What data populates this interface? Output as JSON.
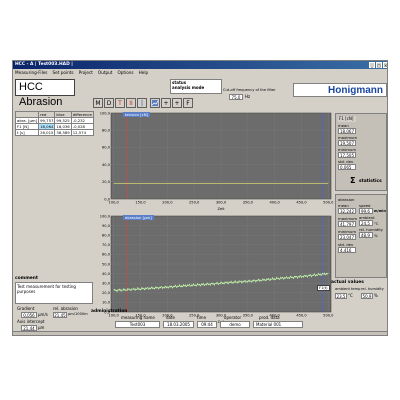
{
  "window": {
    "title": "HCC - A | Test003.HAD |"
  },
  "menu": [
    "Measuring-Files",
    "Set points",
    "Project",
    "Output",
    "Options",
    "Help"
  ],
  "header": {
    "app_title": "HCC Abrasion",
    "status_label": "status",
    "status_value": "analysis mode",
    "cutoff_label": "Cut-off frequency of the filter",
    "cutoff_value": "75,0",
    "cutoff_unit": "Hz",
    "brand": "Honigmann"
  },
  "toolbar": [
    "M",
    "D",
    "T",
    "II",
    "|",
    "chart",
    "+",
    "+",
    "F"
  ],
  "value_table": {
    "headers": [
      "",
      "red",
      "blue",
      "difference"
    ],
    "rows": [
      [
        "abra. [µm]",
        "99,757",
        "99,525",
        "-0,232"
      ],
      [
        "F1 [N]",
        "18,064",
        "18,036",
        "-0,028"
      ],
      [
        "t [s]",
        "26,015",
        "38,589",
        "12,574"
      ]
    ]
  },
  "tension_chart": {
    "label": "tension [cN]",
    "y_ticks": [
      "100,0",
      "80,0",
      "60,0",
      "40,0",
      "20,0",
      "0,0"
    ],
    "x_ticks": [
      "100,0",
      "150,0",
      "200,0",
      "250,0",
      "300,0",
      "350,0",
      "400,0",
      "450,0",
      "500,0"
    ],
    "xlabel": "Zeit"
  },
  "abrasion_chart": {
    "label": "abrasion [µm]",
    "y_ticks": [
      "100,0",
      "90,0",
      "80,0",
      "70,0",
      "60,0",
      "50,0",
      "40,0",
      "30,0",
      "20,0",
      "10,0",
      "0,0"
    ],
    "x_ticks": [
      "100,0",
      "150,0",
      "200,0",
      "250,0",
      "300,0",
      "350,0",
      "400,0",
      "450,0",
      "500,0"
    ],
    "xlabel": "Zeit",
    "cursor_label": "F1(t)"
  },
  "chart_data": [
    {
      "type": "line",
      "xlabel": "Zeit",
      "ylabel": "tension [cN]",
      "xlim": [
        95,
        505
      ],
      "ylim": [
        0,
        100
      ],
      "series": [
        {
          "name": "tension [cN]",
          "x": [
            100,
            500
          ],
          "values": [
            18.1,
            18.1
          ]
        }
      ],
      "cursors": {
        "red": 126.015,
        "blue": 488.589
      },
      "grid": true
    },
    {
      "type": "line",
      "xlabel": "Zeit",
      "ylabel": "abrasion [µm]",
      "xlim": [
        95,
        505
      ],
      "ylim": [
        0,
        100
      ],
      "series": [
        {
          "name": "abrasion [µm]",
          "x": [
            100,
            150,
            200,
            250,
            300,
            350,
            400,
            450,
            500
          ],
          "values": [
            22.5,
            24.0,
            26.0,
            28.0,
            30.0,
            32.0,
            34.5,
            37.0,
            40.0
          ]
        }
      ],
      "cursors": {
        "red": 126.015,
        "blue": 488.589
      },
      "grid": true
    }
  ],
  "stats1": {
    "title": "F1 [cN]",
    "mean_label": "mean",
    "mean": "18,067",
    "maximum_label": "maximum",
    "maximum": "19,507",
    "minimum_label": "minimum",
    "minimum": "17,505",
    "std_label": "std. dev",
    "std": "0,065"
  },
  "stats_heading": {
    "sigma": "Σ",
    "label": "statistics"
  },
  "stats2": {
    "title": "abrasion",
    "mean_label": "mean",
    "mean": "32,242",
    "maximum_label": "maximum",
    "maximum": "41,797",
    "minimum_label": "minimum",
    "minimum": "23,047",
    "std_label": "std. dev",
    "std": "4,416"
  },
  "settings": {
    "speed_label": "speed",
    "speed": "99,6",
    "speed_unit": "m/min",
    "ambient_label": "ambient temp.",
    "ambient": "24,5",
    "ambient_unit": "°C",
    "humidity_label": "rel. humidity",
    "humidity": "48,9",
    "humidity_unit": "%"
  },
  "comment": {
    "title": "comment",
    "text": "Test measurement for testing purposes"
  },
  "gradient": {
    "grad_label": "Gradient",
    "rel_label": "rel. abrasion",
    "grad": "0,056",
    "grad_unit": "µm/s",
    "rel": "21,45",
    "rel_unit": "µm/1000m",
    "intercept_label": "Axis intercept",
    "intercept": "21,44",
    "intercept_unit": "µm"
  },
  "administration": {
    "title": "administration",
    "headers": [
      "measuring name",
      "date",
      "time",
      "operator",
      "prod. data"
    ],
    "values": [
      "Test003",
      "18.03.2005",
      "09:44",
      "demo",
      "Material 001"
    ]
  },
  "actual": {
    "title": "actual values",
    "temp_label": "ambient temp",
    "humid_label": "rel. humidity",
    "temp": "23,5",
    "temp_unit": "°C",
    "humid": "50,9",
    "humid_unit": "%"
  },
  "colors": {
    "plot_bg": "#6c6c6c",
    "tension_line": "#e8e870",
    "abrasion_line": "#c8ffb0",
    "cursor_red": "#e04040",
    "cursor_blue": "#4060ff",
    "brand": "#1846a0"
  }
}
